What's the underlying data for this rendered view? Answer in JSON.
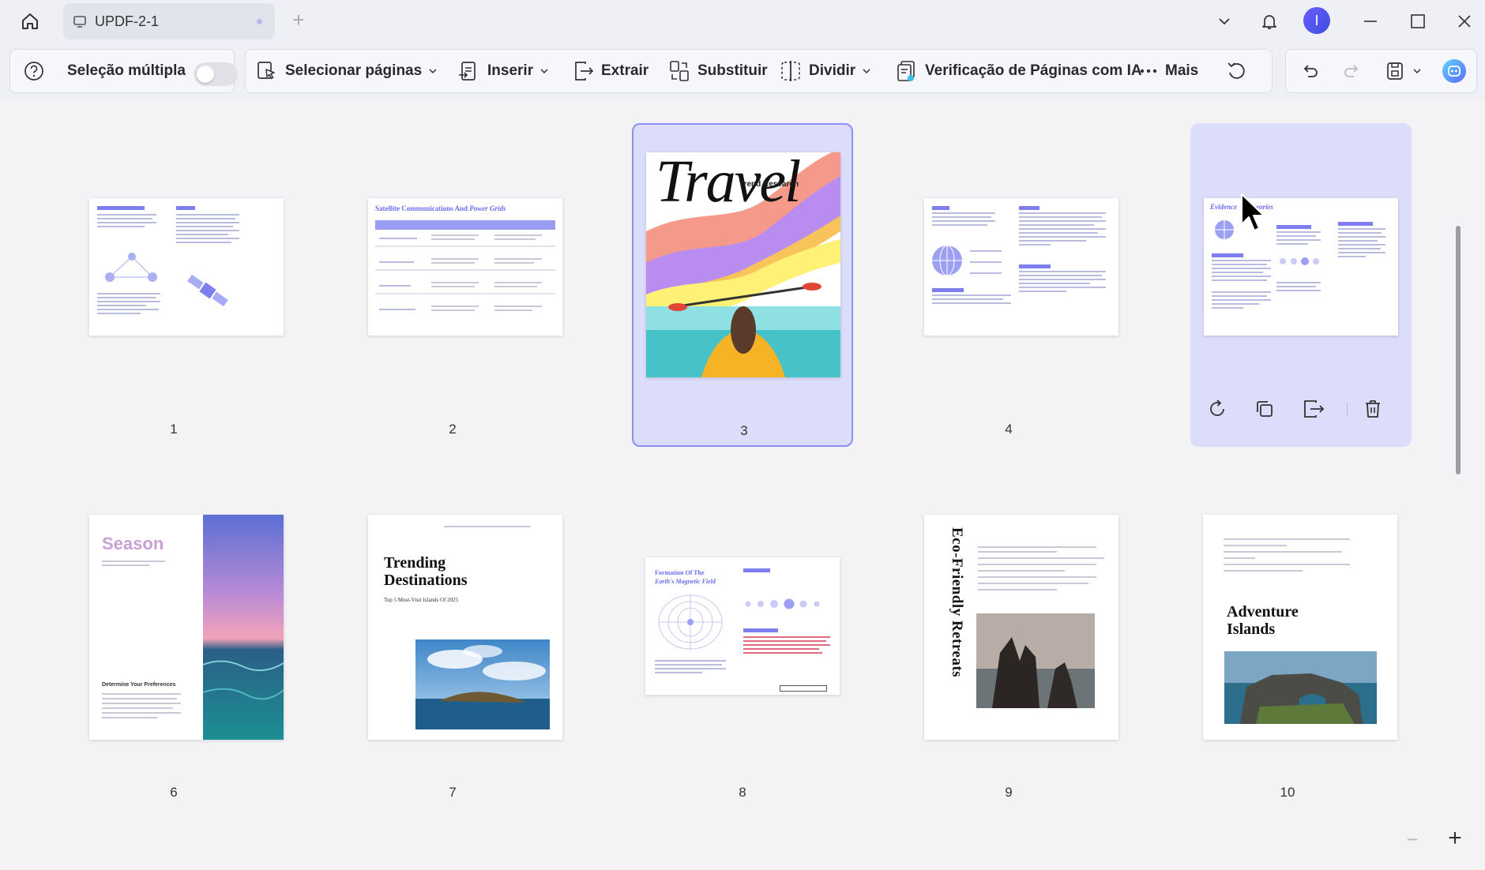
{
  "window": {
    "tab_title": "UPDF-2-1",
    "new_tab_label": "+",
    "avatar_initial": "I"
  },
  "toolbar": {
    "multi_select_label": "Seleção múltipla",
    "multi_select_on": false,
    "select_pages_label": "Selecionar páginas",
    "insert_label": "Inserir",
    "extract_label": "Extrair",
    "replace_label": "Substituir",
    "split_label": "Dividir",
    "ai_check_label": "Verificação de Páginas com IA",
    "more_label": "Mais"
  },
  "pages": [
    {
      "number": "1",
      "state": "normal"
    },
    {
      "number": "2",
      "state": "normal",
      "title": "Satellite Communications And",
      "title_italic": "Power Grids"
    },
    {
      "number": "3",
      "state": "selected",
      "script_title": "Travel",
      "subtitle": "Trend Research"
    },
    {
      "number": "4",
      "state": "normal"
    },
    {
      "number": "5",
      "state": "hovered",
      "title": "Evidence",
      "title_tail": "Theories"
    },
    {
      "number": "6",
      "state": "normal",
      "title": "Season",
      "heading": "Determine Your Preferences"
    },
    {
      "number": "7",
      "state": "normal",
      "title_line1": "Trending",
      "title_line2": "Destinations",
      "sub": "Top 5 Must-Visit Islands Of 2025"
    },
    {
      "number": "8",
      "state": "normal",
      "title": "Formation Of The",
      "title_italic": "Earth's Magnetic Field"
    },
    {
      "number": "9",
      "state": "normal",
      "vertical_title": "Eco-Friendly Retreats"
    },
    {
      "number": "10",
      "state": "normal",
      "title_line1": "Adventure",
      "title_line2": "Islands"
    }
  ],
  "zoom": {
    "minus": "−",
    "plus": "+"
  },
  "colors": {
    "accent": "#7d7ff0",
    "selected_bg": "#dcdcfb",
    "selected_border": "#8f8ff0"
  }
}
